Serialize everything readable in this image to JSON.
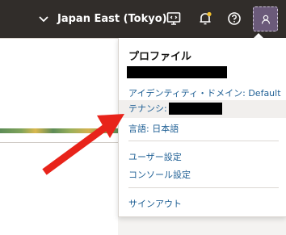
{
  "header": {
    "region_label": "Japan East (Tokyo)",
    "icons": [
      "chevron-down-icon",
      "developer-tools-icon",
      "notifications-bell-icon",
      "help-icon",
      "profile-avatar-icon"
    ]
  },
  "profile_menu": {
    "title": "プロファイル",
    "identity_domain": "アイデンティティ・ドメイン: Default",
    "tenancy_label": "テナンシ:",
    "language": "言語: 日本語",
    "user_settings": "ユーザー設定",
    "console_settings": "コンソール設定",
    "sign_out": "サインアウト"
  },
  "colors": {
    "topbar": "#312d2a",
    "link": "#1e5f94",
    "annotation_arrow": "#e8231a",
    "notification_dot": "#f2c12e"
  }
}
